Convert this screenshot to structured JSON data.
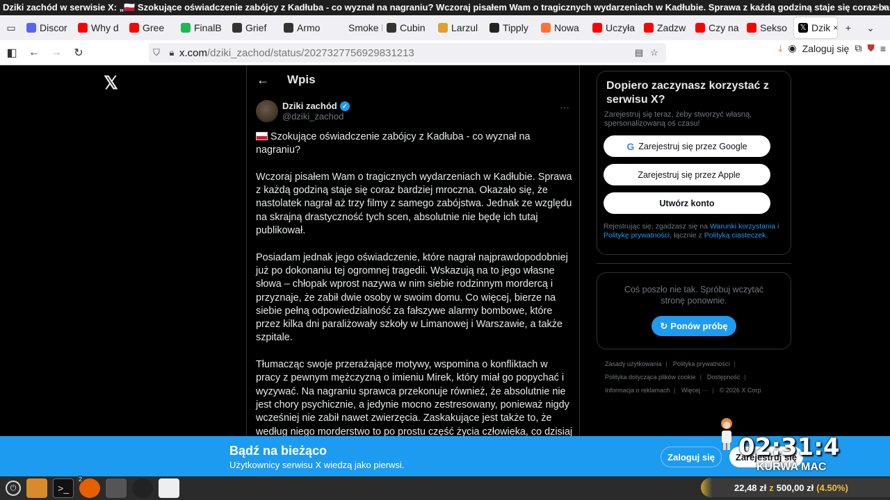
{
  "window": {
    "title": "Dziki zachód w serwisie X: „🇵🇱 Szokujące oświadczenie zabójcy z Kadłuba - co wyznał na nagraniu? Wczoraj pisałem Wam o tragicznych wydarzeniach w Kadłubie. Sprawa z każdą godziną staje się coraz bardz...–",
    "controls": "+ +"
  },
  "tabs": [
    {
      "label": "Discor",
      "color": "#5865f2"
    },
    {
      "label": "Why d",
      "color": "#ff0000"
    },
    {
      "label": "Gree",
      "color": "#ff0000"
    },
    {
      "label": "FinalB",
      "color": "#1db954"
    },
    {
      "label": "Grief",
      "color": "#333333"
    },
    {
      "label": "Armo",
      "color": "#333333"
    },
    {
      "label": "Smoke R",
      "color": "#f0f0f4"
    },
    {
      "label": "Cubin",
      "color": "#333333"
    },
    {
      "label": "Larzul",
      "color": "#e0a030"
    },
    {
      "label": "Tipply",
      "color": "#222222"
    },
    {
      "label": "Nowa",
      "color": "#ff7139"
    },
    {
      "label": "Uczyła",
      "color": "#ff0000"
    },
    {
      "label": "Zadzw",
      "color": "#ff0000"
    },
    {
      "label": "Czy na",
      "color": "#ff0000"
    },
    {
      "label": "Sekso",
      "color": "#ff0000"
    }
  ],
  "active_tab": {
    "label": "Dzik",
    "close": "×"
  },
  "new_tab": "+",
  "tab_menu": "⌄",
  "url": {
    "host": "x.com",
    "path": "/dziki_zachod/status/2027327756929831213"
  },
  "nav_login": "Zaloguj się",
  "post_header": {
    "back": "←",
    "title": "Wpis"
  },
  "author": {
    "name": "Dziki zachód",
    "handle": "@dziki_zachod",
    "more": "···"
  },
  "post": {
    "p1": "Szokujące oświadczenie zabójcy z Kadłuba - co wyznał na nagraniu?",
    "p2": "Wczoraj pisałem Wam o tragicznych wydarzeniach w Kadłubie. Sprawa z każdą godziną staje się coraz bardziej mroczna. Okazało się, że nastolatek nagrał aż trzy filmy z samego zabójstwa. Jednak ze względu na skrajną drastyczność tych scen, absolutnie nie będę ich tutaj publikował.",
    "p3": "Posiadam jednak jego oświadczenie, które nagrał najprawdopodobniej już po dokonaniu tej ogromnej tragedii. Wskazują na to jego własne słowa – chłopak wprost nazywa w nim siebie rodzinnym mordercą i przyznaje, że zabił dwie osoby w swoim domu. Co więcej, bierze na siebie pełną odpowiedzialność za fałszywe alarmy bombowe, które przez kilka dni paraliżowały szkoły w Limanowej i Warszawie, a także szpitale.",
    "p4": "Tłumacząc swoje przerażające motywy, wspomina o konfliktach w pracy z pewnym mężczyzną o imieniu Mirek, który miał go popychać i wyzywać. Na nagraniu sprawca przekonuje również, że absolutnie nie jest chory psychicznie, a jedynie mocno zestresowany, ponieważ nigdy wcześniej nie zabił nawet zwierzęcia. Zaskakujące jest także to, że według niego morderstwo to po prostu część życia człowieka, co dzisiaj przypisuje się psychopatom. To wideo dokładnie pokazuje przerażający sposób myślenia sprawcy."
  },
  "signup": {
    "title": "Dopiero zaczynasz korzystać z serwisu X?",
    "subtitle": "Zarejestruj się teraz, żeby stworzyć własną, spersonalizowaną oś czasu!",
    "google": "Zarejestruj się przez Google",
    "apple": "Zarejestruj się przez Apple",
    "create": "Utwórz konto",
    "legal_1": "Rejestrując się, zgadzasz się na ",
    "terms": "Warunki korzystania",
    "legal_2": " i ",
    "privacy": "Politykę prywatności",
    "legal_3": ", łącznie z ",
    "cookies": "Polityką ciasteczek",
    "legal_4": "."
  },
  "error_card": {
    "message": "Coś poszło nie tak. Spróbuj wczytać stronę ponownie.",
    "retry": "Ponów próbę"
  },
  "footer": {
    "terms": "Zasady użytkowania",
    "privacy": "Polityka prywatności",
    "cookies": "Polityka dotycząca plików cookie",
    "accessibility": "Dostępność",
    "ads": "Informacja o reklamach",
    "more": "Więcej ···",
    "copyright": "© 2026 X Corp."
  },
  "banner": {
    "title": "Bądź na bieżąco",
    "subtitle": "Użytkownicy serwisu X wiedzą jako pierwsi.",
    "login": "Zaloguj się",
    "register": "Zarejestruj się"
  },
  "overlay": {
    "clock": "02:31:4",
    "text": "KURWA MAC",
    "amount": "22,48 zł",
    "of": "z",
    "goal": "500,00 zł",
    "pct": "(4.50%)"
  },
  "taskbar": {
    "badge": "2"
  }
}
